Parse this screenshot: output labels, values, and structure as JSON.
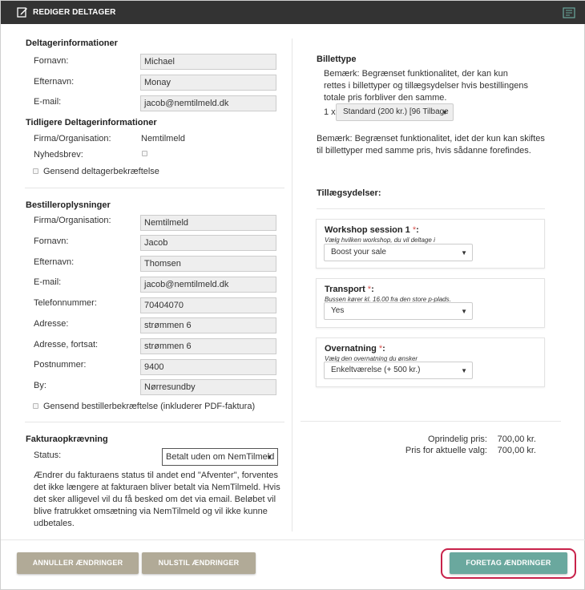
{
  "window": {
    "title": "REDIGER DELTAGER",
    "icon_left": "edit-icon",
    "icon_right": "document-icon"
  },
  "participant": {
    "heading": "Deltagerinformationer",
    "fields": [
      {
        "label": "Fornavn:",
        "value": "Michael"
      },
      {
        "label": "Efternavn:",
        "value": "Monay"
      },
      {
        "label": "E-mail:",
        "value": "jacob@nemtilmeld.dk"
      }
    ]
  },
  "previous": {
    "heading": "Tidligere Deltagerinformationer",
    "org_label": "Firma/Organisation:",
    "org_value": "Nemtilmeld",
    "newsletter_label": "Nyhedsbrev:",
    "resend_label": "Gensend deltagerbekræftelse"
  },
  "orderer": {
    "heading": "Bestilleroplysninger",
    "fields": [
      {
        "label": "Firma/Organisation:",
        "value": "Nemtilmeld"
      },
      {
        "label": "Fornavn:",
        "value": "Jacob"
      },
      {
        "label": "Efternavn:",
        "value": "Thomsen"
      },
      {
        "label": "E-mail:",
        "value": "jacob@nemtilmeld.dk"
      },
      {
        "label": "Telefonnummer:",
        "value": "70404070"
      },
      {
        "label": "Adresse:",
        "value": "strømmen 6"
      },
      {
        "label": "Adresse, fortsat:",
        "value": "strømmen 6"
      },
      {
        "label": "Postnummer:",
        "value": "9400"
      },
      {
        "label": "By:",
        "value": "Nørresundby"
      }
    ],
    "resend_label": "Gensend bestillerbekræftelse (inkluderer PDF-faktura)"
  },
  "invoice": {
    "heading": "Fakturaopkrævning",
    "status_label": "Status:",
    "status_value": "Betalt uden om NemTilmeld",
    "note": "Ændrer du fakturaens status til andet end \"Afventer\", forventes det ikke længere at fakturaen bliver betalt via NemTilmeld. Hvis det sker alligevel vil du få besked om det via email. Beløbet vil blive fratrukket omsætning via NemTilmeld og vil ikke kunne udbetales."
  },
  "ticket": {
    "heading": "Billettype",
    "note1": "Bemærk: Begrænset funktionalitet, der kan kun rettes i billettyper og tillægsydelser hvis bestillingens totale pris forbliver den samme.",
    "qty": "1 x",
    "select_value": "Standard (200 kr.) [96 Tilbage",
    "note2": "Bemærk: Begrænset funktionalitet, idet der kun kan skiftes til billettyper med samme pris, hvis sådanne forefindes."
  },
  "addons": {
    "heading": "Tillægsydelser:",
    "items": [
      {
        "title": "Workshop session 1",
        "required": "*",
        "help": "Vælg hvilken workshop, du vil deltage i",
        "value": "Boost your sale"
      },
      {
        "title": "Transport",
        "required": "*",
        "help": "Bussen kører kl. 16.00 fra den store p-plads.",
        "value": "Yes"
      },
      {
        "title": "Overnatning",
        "required": "*",
        "help": "Vælg den overnatning du ønsker",
        "value": "Enkeltværelse (+ 500 kr.)"
      }
    ]
  },
  "prices": {
    "original_label": "Oprindelig pris:",
    "original_value": "700,00 kr.",
    "current_label": "Pris for aktuelle valg:",
    "current_value": "700,00 kr."
  },
  "buttons": {
    "cancel": "ANNULLER ÆNDRINGER",
    "reset": "NULSTIL ÆNDRINGER",
    "submit": "FORETAG ÆNDRINGER"
  },
  "colors": {
    "titlebar": "#333333",
    "button_tan": "#b1aa97",
    "button_teal": "#6aa89e",
    "highlight_ring": "#c8224a",
    "required_star": "#d9534f"
  }
}
